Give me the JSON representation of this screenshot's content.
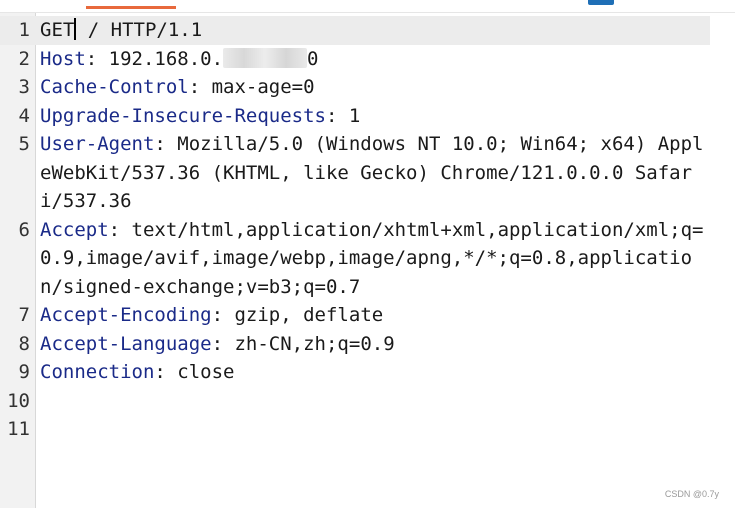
{
  "colors": {
    "header_key": "#1a2a88",
    "tab_accent": "#e8693c",
    "button": "#1f6fb6"
  },
  "lines": [
    {
      "n": "1",
      "request_a": "GET",
      "request_b": " / HTTP/1.1"
    },
    {
      "n": "2",
      "key": "Host",
      "sep": ": ",
      "value": "192.168.0.",
      "tail": "0"
    },
    {
      "n": "3",
      "key": "Cache-Control",
      "sep": ": ",
      "value": "max-age=0"
    },
    {
      "n": "4",
      "key": "Upgrade-Insecure-Requests",
      "sep": ": ",
      "value": "1"
    },
    {
      "n": "5",
      "key": "User-Agent",
      "sep": ": ",
      "value": "Mozilla/5.0 (Windows NT 10.0; Win64; x64) AppleWebKit/537.36 (KHTML, like Gecko) Chrome/121.0.0.0 Safari/537.36"
    },
    {
      "n": "6",
      "key": "Accept",
      "sep": ": ",
      "value": "text/html,application/xhtml+xml,application/xml;q=0.9,image/avif,image/webp,image/apng,*/*;q=0.8,application/signed-exchange;v=b3;q=0.7"
    },
    {
      "n": "7",
      "key": "Accept-Encoding",
      "sep": ": ",
      "value": "gzip, deflate"
    },
    {
      "n": "8",
      "key": "Accept-Language",
      "sep": ": ",
      "value": "zh-CN,zh;q=0.9"
    },
    {
      "n": "9",
      "key": "Connection",
      "sep": ": ",
      "value": "close"
    },
    {
      "n": "10"
    },
    {
      "n": "11"
    }
  ],
  "watermark": "CSDN @0.7y"
}
